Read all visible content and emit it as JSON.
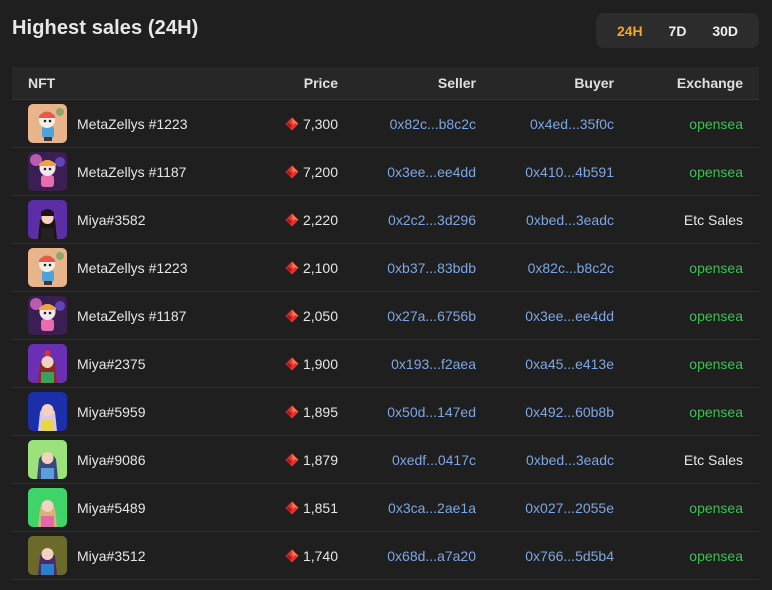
{
  "header": {
    "title": "Highest sales (24H)",
    "tabs": [
      {
        "label": "24H",
        "active": true
      },
      {
        "label": "7D",
        "active": false
      },
      {
        "label": "30D",
        "active": false
      }
    ]
  },
  "columns": {
    "nft": "NFT",
    "price": "Price",
    "seller": "Seller",
    "buyer": "Buyer",
    "exchange": "Exchange"
  },
  "rows": [
    {
      "name": "MetaZellys #1223",
      "avatar": "metazellys-orange",
      "price": "7,300",
      "seller": "0x82c...b8c2c",
      "buyer": "0x4ed...35f0c",
      "exchange": "opensea"
    },
    {
      "name": "MetaZellys #1187",
      "avatar": "metazellys-purple",
      "price": "7,200",
      "seller": "0x3ee...ee4dd",
      "buyer": "0x410...4b591",
      "exchange": "opensea"
    },
    {
      "name": "Miya#3582",
      "avatar": "miya-purple",
      "price": "2,220",
      "seller": "0x2c2...3d296",
      "buyer": "0xbed...3eadc",
      "exchange": "Etc Sales"
    },
    {
      "name": "MetaZellys #1223",
      "avatar": "metazellys-orange",
      "price": "2,100",
      "seller": "0xb37...83bdb",
      "buyer": "0x82c...b8c2c",
      "exchange": "opensea"
    },
    {
      "name": "MetaZellys #1187",
      "avatar": "metazellys-purple",
      "price": "2,050",
      "seller": "0x27a...6756b",
      "buyer": "0x3ee...ee4dd",
      "exchange": "opensea"
    },
    {
      "name": "Miya#2375",
      "avatar": "miya-purple-red",
      "price": "1,900",
      "seller": "0x193...f2aea",
      "buyer": "0xa45...e413e",
      "exchange": "opensea"
    },
    {
      "name": "Miya#5959",
      "avatar": "miya-blue",
      "price": "1,895",
      "seller": "0x50d...147ed",
      "buyer": "0x492...60b8b",
      "exchange": "opensea"
    },
    {
      "name": "Miya#9086",
      "avatar": "miya-green",
      "price": "1,879",
      "seller": "0xedf...0417c",
      "buyer": "0xbed...3eadc",
      "exchange": "Etc Sales"
    },
    {
      "name": "Miya#5489",
      "avatar": "miya-green-bright",
      "price": "1,851",
      "seller": "0x3ca...2ae1a",
      "buyer": "0x027...2055e",
      "exchange": "opensea"
    },
    {
      "name": "Miya#3512",
      "avatar": "miya-olive",
      "price": "1,740",
      "seller": "0x68d...a7a20",
      "buyer": "0x766...5d5b4",
      "exchange": "opensea"
    }
  ],
  "colors": {
    "accent": "#f5a623",
    "address": "#7ea6e0",
    "opensea": "#3fbf57",
    "price_icon": "#e0342c"
  },
  "icons": {
    "price": "klay-token-icon"
  }
}
